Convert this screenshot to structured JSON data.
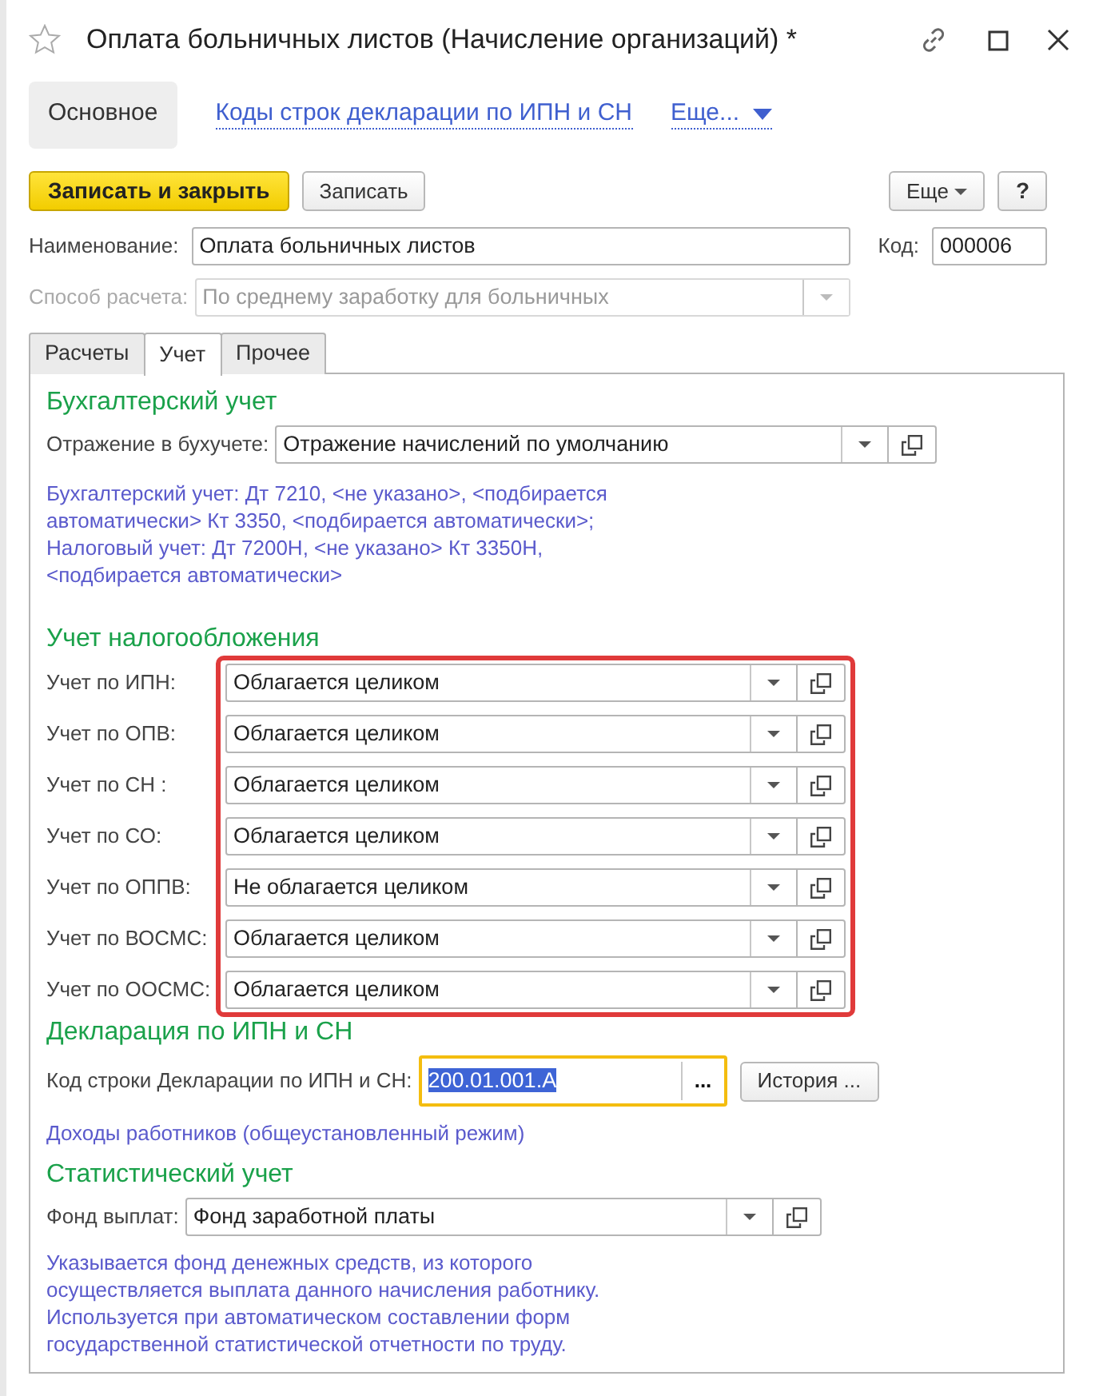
{
  "window": {
    "title": "Оплата больничных листов (Начисление организаций) *",
    "favorite": false
  },
  "nav": [
    {
      "label": "Основное",
      "selected": true,
      "kind": "tab"
    },
    {
      "label": "Коды строк декларации по ИПН и СН",
      "selected": false,
      "kind": "link"
    },
    {
      "label": "Еще...",
      "selected": false,
      "kind": "menu"
    }
  ],
  "toolbar": {
    "primary": "Записать и закрыть",
    "save": "Записать",
    "more": "Еще",
    "help": "?"
  },
  "name_field": {
    "label": "Наименование:",
    "value": "Оплата больничных листов"
  },
  "code_field": {
    "label": "Код:",
    "value": "000006"
  },
  "method_field": {
    "label": "Способ расчета:",
    "value": "По среднему заработку для больничных",
    "disabled": true
  },
  "tabs": [
    {
      "label": "Расчеты",
      "selected": false
    },
    {
      "label": "Учет",
      "selected": true
    },
    {
      "label": "Прочее",
      "selected": false
    }
  ],
  "accounting": {
    "heading": "Бухгалтерский учет",
    "label": "Отражение в бухучете:",
    "value": "Отражение начислений по умолчанию",
    "note": "Бухгалтерский учет: Дт 7210, <не указано>, <подбирается автоматически> Кт 3350, <подбирается автоматически>; Налоговый учет: Дт 7200Н, <не указано> Кт 3350Н, <подбирается автоматически>"
  },
  "taxation": {
    "heading": "Учет налогообложения",
    "highlighted": true,
    "rows": [
      {
        "label": "Учет по ИПН:",
        "value": "Облагается целиком"
      },
      {
        "label": "Учет по ОПВ:",
        "value": "Облагается целиком"
      },
      {
        "label": "Учет по СН :",
        "value": "Облагается целиком"
      },
      {
        "label": "Учет по СО:",
        "value": "Облагается целиком"
      },
      {
        "label": "Учет по ОППВ:",
        "value": "Не облагается целиком"
      },
      {
        "label": "Учет по ВОСМС:",
        "value": "Облагается целиком"
      },
      {
        "label": "Учет по ООСМС:",
        "value": "Облагается целиком"
      }
    ]
  },
  "declaration": {
    "heading": "Декларация по ИПН и СН",
    "label": "Код строки Декларации по ИПН и СН:",
    "value": "200.01.001.A",
    "focused": true,
    "choose": "...",
    "history": "История ...",
    "note": "Доходы работников (общеустановленный режим)"
  },
  "statistics": {
    "heading": "Статистический учет",
    "label": "Фонд выплат:",
    "value": "Фонд заработной платы",
    "note": "Указывается фонд денежных средств, из которого осуществляется выплата данного начисления работнику. Используется при автоматическом составлении форм государственной статистической отчетности по труду."
  }
}
